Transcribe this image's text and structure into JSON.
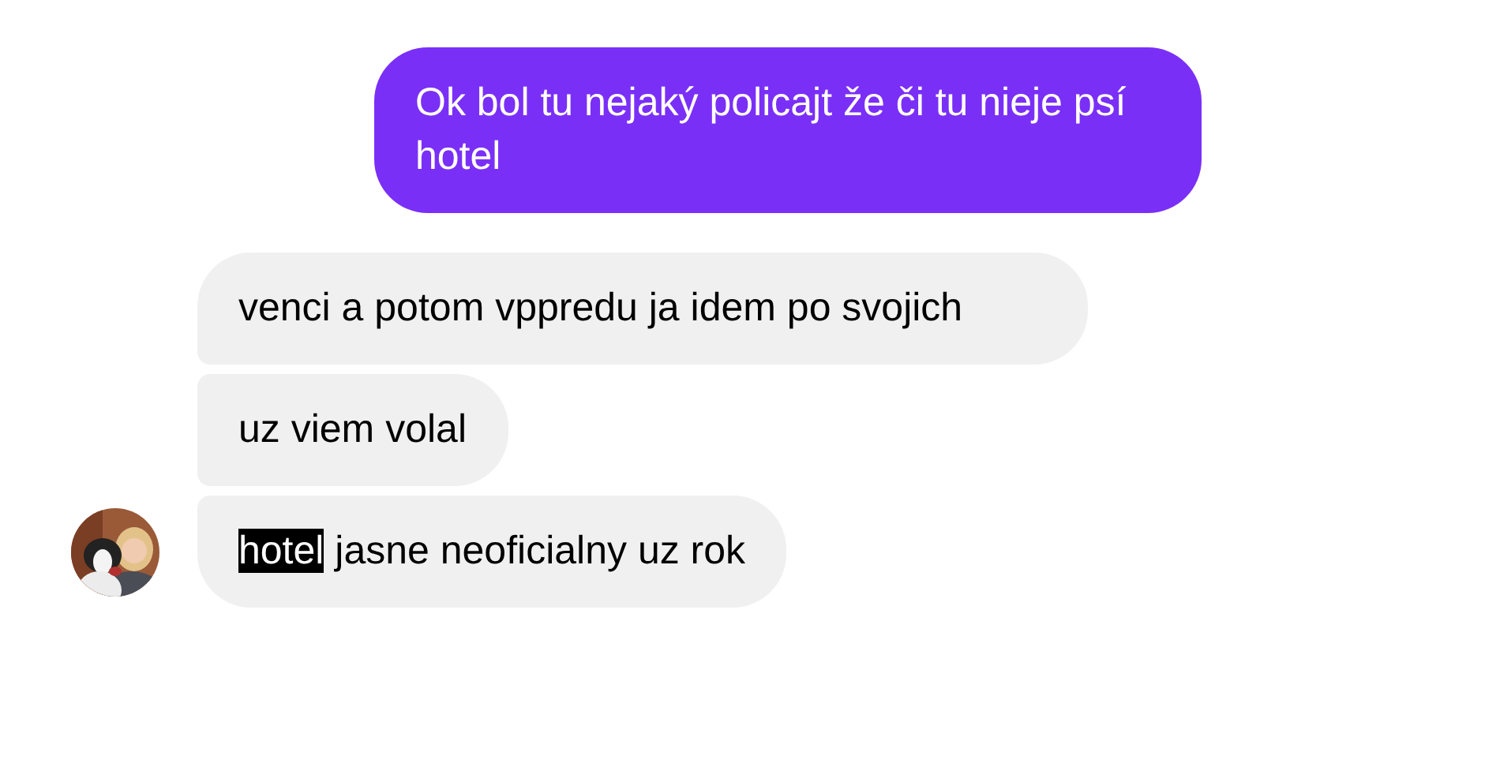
{
  "messages": [
    {
      "kind": "sent",
      "segments": [
        {
          "text": "Ok bol tu nejaký policajt že či tu nieje psí hotel",
          "highlighted": false
        }
      ]
    },
    {
      "kind": "received",
      "segments": [
        {
          "text": "venci a potom vppredu ja idem po svojich",
          "highlighted": false
        }
      ]
    },
    {
      "kind": "received",
      "segments": [
        {
          "text": "uz viem volal",
          "highlighted": false
        }
      ]
    },
    {
      "kind": "received",
      "segments": [
        {
          "text": "hotel",
          "highlighted": true
        },
        {
          "text": " jasne neoficialny uz rok",
          "highlighted": false
        }
      ]
    }
  ]
}
